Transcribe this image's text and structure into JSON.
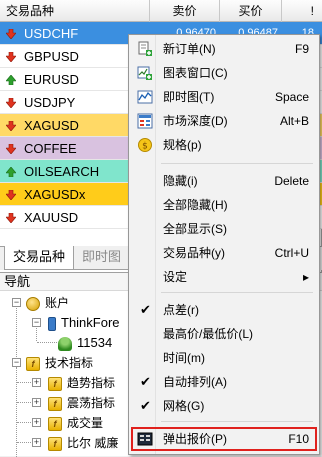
{
  "market_watch": {
    "header": {
      "symbol": "交易品种",
      "bid": "卖价",
      "ask": "买价",
      "spread": "!"
    },
    "rows": [
      {
        "symbol": "USDCHF",
        "bid": "0.96470",
        "ask": "0.96487",
        "spread": "18",
        "bg": "#3b8fe0",
        "fg": "#ffffff",
        "arrow": "down"
      },
      {
        "symbol": "GBPUSD",
        "bid": "",
        "ask": "",
        "spread": "",
        "bg": "#ffffff",
        "fg": "#000000",
        "arrow": "down"
      },
      {
        "symbol": "EURUSD",
        "bid": "",
        "ask": "",
        "spread": "",
        "bg": "#ffffff",
        "fg": "#000000",
        "arrow": "up"
      },
      {
        "symbol": "USDJPY",
        "bid": "",
        "ask": "",
        "spread": "",
        "bg": "#ffffff",
        "fg": "#000000",
        "arrow": "down"
      },
      {
        "symbol": "XAGUSD",
        "bid": "",
        "ask": "",
        "spread": "",
        "bg": "#ffd966",
        "fg": "#000000",
        "arrow": "down"
      },
      {
        "symbol": "COFFEE",
        "bid": "",
        "ask": "",
        "spread": "",
        "bg": "#d9c2e0",
        "fg": "#000000",
        "arrow": "down"
      },
      {
        "symbol": "OILSEARCH",
        "bid": "",
        "ask": "",
        "spread": "",
        "bg": "#80e5cc",
        "fg": "#000000",
        "arrow": "up"
      },
      {
        "symbol": "XAGUSDx",
        "bid": "",
        "ask": "",
        "spread": "",
        "bg": "#ffcc1a",
        "fg": "#000000",
        "arrow": "down"
      },
      {
        "symbol": "XAUUSD",
        "bid": "",
        "ask": "",
        "spread": "",
        "bg": "#ffffff",
        "fg": "#000000",
        "arrow": "down"
      }
    ],
    "tabs": [
      "交易品种",
      "即时图"
    ]
  },
  "navigator": {
    "title": "导航",
    "accounts_label": "账户",
    "server_label": "ThinkFore",
    "account_number": "11534",
    "indicators_label": "技术指标",
    "indicator_groups": [
      "趋势指标",
      "震荡指标",
      "成交量",
      "比尔 威廉"
    ]
  },
  "context_menu": {
    "items": [
      {
        "label": "新订单(N)",
        "shortcut": "F9",
        "icon": "new-order-icon"
      },
      {
        "label": "图表窗口(C)",
        "shortcut": "",
        "icon": "chart-window-icon"
      },
      {
        "label": "即时图(T)",
        "shortcut": "Space",
        "icon": "tick-chart-icon"
      },
      {
        "label": "市场深度(D)",
        "shortcut": "Alt+B",
        "icon": "depth-of-market-icon"
      },
      {
        "label": "规格(p)",
        "shortcut": "",
        "icon": "specification-icon"
      },
      {
        "label": "隐藏(i)",
        "shortcut": "Delete",
        "icon": ""
      },
      {
        "label": "全部隐藏(H)",
        "shortcut": "",
        "icon": ""
      },
      {
        "label": "全部显示(S)",
        "shortcut": "",
        "icon": ""
      },
      {
        "label": "交易品种(y)",
        "shortcut": "Ctrl+U",
        "icon": ""
      },
      {
        "label": "设定",
        "shortcut": "▸",
        "icon": ""
      },
      {
        "label": "点差(r)",
        "shortcut": "",
        "checked": true
      },
      {
        "label": "最高价/最低价(L)",
        "shortcut": "",
        "checked": false
      },
      {
        "label": "时间(m)",
        "shortcut": "",
        "checked": false
      },
      {
        "label": "自动排列(A)",
        "shortcut": "",
        "checked": true
      },
      {
        "label": "网格(G)",
        "shortcut": "",
        "checked": true
      },
      {
        "label": "弹出报价(P)",
        "shortcut": "F10",
        "icon": "popup-prices-icon"
      }
    ],
    "highlight_color": "#e0211d"
  }
}
